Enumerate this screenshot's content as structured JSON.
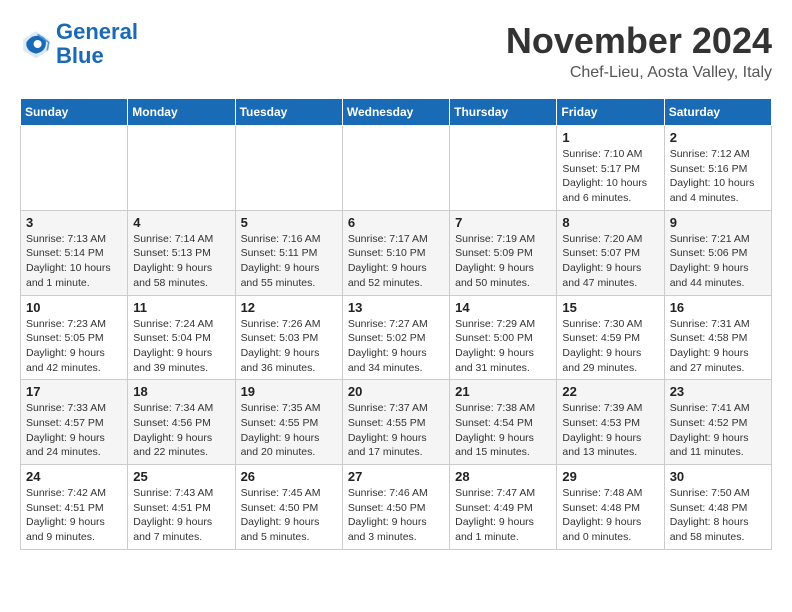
{
  "logo": {
    "line1": "General",
    "line2": "Blue"
  },
  "title": "November 2024",
  "subtitle": "Chef-Lieu, Aosta Valley, Italy",
  "weekdays": [
    "Sunday",
    "Monday",
    "Tuesday",
    "Wednesday",
    "Thursday",
    "Friday",
    "Saturday"
  ],
  "weeks": [
    [
      {
        "day": "",
        "info": ""
      },
      {
        "day": "",
        "info": ""
      },
      {
        "day": "",
        "info": ""
      },
      {
        "day": "",
        "info": ""
      },
      {
        "day": "",
        "info": ""
      },
      {
        "day": "1",
        "info": "Sunrise: 7:10 AM\nSunset: 5:17 PM\nDaylight: 10 hours\nand 6 minutes."
      },
      {
        "day": "2",
        "info": "Sunrise: 7:12 AM\nSunset: 5:16 PM\nDaylight: 10 hours\nand 4 minutes."
      }
    ],
    [
      {
        "day": "3",
        "info": "Sunrise: 7:13 AM\nSunset: 5:14 PM\nDaylight: 10 hours\nand 1 minute."
      },
      {
        "day": "4",
        "info": "Sunrise: 7:14 AM\nSunset: 5:13 PM\nDaylight: 9 hours\nand 58 minutes."
      },
      {
        "day": "5",
        "info": "Sunrise: 7:16 AM\nSunset: 5:11 PM\nDaylight: 9 hours\nand 55 minutes."
      },
      {
        "day": "6",
        "info": "Sunrise: 7:17 AM\nSunset: 5:10 PM\nDaylight: 9 hours\nand 52 minutes."
      },
      {
        "day": "7",
        "info": "Sunrise: 7:19 AM\nSunset: 5:09 PM\nDaylight: 9 hours\nand 50 minutes."
      },
      {
        "day": "8",
        "info": "Sunrise: 7:20 AM\nSunset: 5:07 PM\nDaylight: 9 hours\nand 47 minutes."
      },
      {
        "day": "9",
        "info": "Sunrise: 7:21 AM\nSunset: 5:06 PM\nDaylight: 9 hours\nand 44 minutes."
      }
    ],
    [
      {
        "day": "10",
        "info": "Sunrise: 7:23 AM\nSunset: 5:05 PM\nDaylight: 9 hours\nand 42 minutes."
      },
      {
        "day": "11",
        "info": "Sunrise: 7:24 AM\nSunset: 5:04 PM\nDaylight: 9 hours\nand 39 minutes."
      },
      {
        "day": "12",
        "info": "Sunrise: 7:26 AM\nSunset: 5:03 PM\nDaylight: 9 hours\nand 36 minutes."
      },
      {
        "day": "13",
        "info": "Sunrise: 7:27 AM\nSunset: 5:02 PM\nDaylight: 9 hours\nand 34 minutes."
      },
      {
        "day": "14",
        "info": "Sunrise: 7:29 AM\nSunset: 5:00 PM\nDaylight: 9 hours\nand 31 minutes."
      },
      {
        "day": "15",
        "info": "Sunrise: 7:30 AM\nSunset: 4:59 PM\nDaylight: 9 hours\nand 29 minutes."
      },
      {
        "day": "16",
        "info": "Sunrise: 7:31 AM\nSunset: 4:58 PM\nDaylight: 9 hours\nand 27 minutes."
      }
    ],
    [
      {
        "day": "17",
        "info": "Sunrise: 7:33 AM\nSunset: 4:57 PM\nDaylight: 9 hours\nand 24 minutes."
      },
      {
        "day": "18",
        "info": "Sunrise: 7:34 AM\nSunset: 4:56 PM\nDaylight: 9 hours\nand 22 minutes."
      },
      {
        "day": "19",
        "info": "Sunrise: 7:35 AM\nSunset: 4:55 PM\nDaylight: 9 hours\nand 20 minutes."
      },
      {
        "day": "20",
        "info": "Sunrise: 7:37 AM\nSunset: 4:55 PM\nDaylight: 9 hours\nand 17 minutes."
      },
      {
        "day": "21",
        "info": "Sunrise: 7:38 AM\nSunset: 4:54 PM\nDaylight: 9 hours\nand 15 minutes."
      },
      {
        "day": "22",
        "info": "Sunrise: 7:39 AM\nSunset: 4:53 PM\nDaylight: 9 hours\nand 13 minutes."
      },
      {
        "day": "23",
        "info": "Sunrise: 7:41 AM\nSunset: 4:52 PM\nDaylight: 9 hours\nand 11 minutes."
      }
    ],
    [
      {
        "day": "24",
        "info": "Sunrise: 7:42 AM\nSunset: 4:51 PM\nDaylight: 9 hours\nand 9 minutes."
      },
      {
        "day": "25",
        "info": "Sunrise: 7:43 AM\nSunset: 4:51 PM\nDaylight: 9 hours\nand 7 minutes."
      },
      {
        "day": "26",
        "info": "Sunrise: 7:45 AM\nSunset: 4:50 PM\nDaylight: 9 hours\nand 5 minutes."
      },
      {
        "day": "27",
        "info": "Sunrise: 7:46 AM\nSunset: 4:50 PM\nDaylight: 9 hours\nand 3 minutes."
      },
      {
        "day": "28",
        "info": "Sunrise: 7:47 AM\nSunset: 4:49 PM\nDaylight: 9 hours\nand 1 minute."
      },
      {
        "day": "29",
        "info": "Sunrise: 7:48 AM\nSunset: 4:48 PM\nDaylight: 9 hours\nand 0 minutes."
      },
      {
        "day": "30",
        "info": "Sunrise: 7:50 AM\nSunset: 4:48 PM\nDaylight: 8 hours\nand 58 minutes."
      }
    ]
  ]
}
